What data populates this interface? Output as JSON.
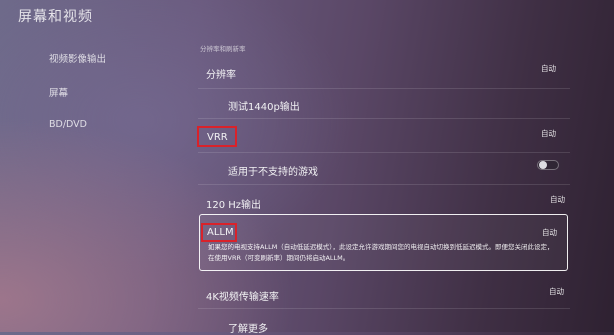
{
  "page_title": "屏幕和视频",
  "nav": {
    "items": [
      {
        "label": "视频影像输出"
      },
      {
        "label": "屏幕"
      },
      {
        "label": "BD/DVD"
      }
    ]
  },
  "section_label": "分辨率和刷新率",
  "settings": {
    "resolution": {
      "label": "分辨率",
      "value": "自动"
    },
    "test_1440p": {
      "label": "测试1440p输出"
    },
    "vrr": {
      "label": "VRR",
      "value": "自动"
    },
    "vrr_unsupported": {
      "label": "适用于不支持的游戏",
      "toggle_on": false
    },
    "hz120": {
      "label": "120 Hz输出",
      "value": "自动"
    },
    "allm": {
      "label": "ALLM",
      "value": "自动",
      "description": "如果您的电视支持ALLM（自动低延迟模式），此设定允许游戏期间您的电视自动切换到低延迟模式。即便您关闭此设定，在使用VRR（可变刷新率）期间仍将启动ALLM。"
    },
    "transfer_rate": {
      "label": "4K视频传输速率",
      "value": "自动"
    },
    "learn_more": {
      "label": "了解更多"
    }
  },
  "colors": {
    "highlight_box": "#d9222a",
    "focus_border": "#ffffff"
  }
}
